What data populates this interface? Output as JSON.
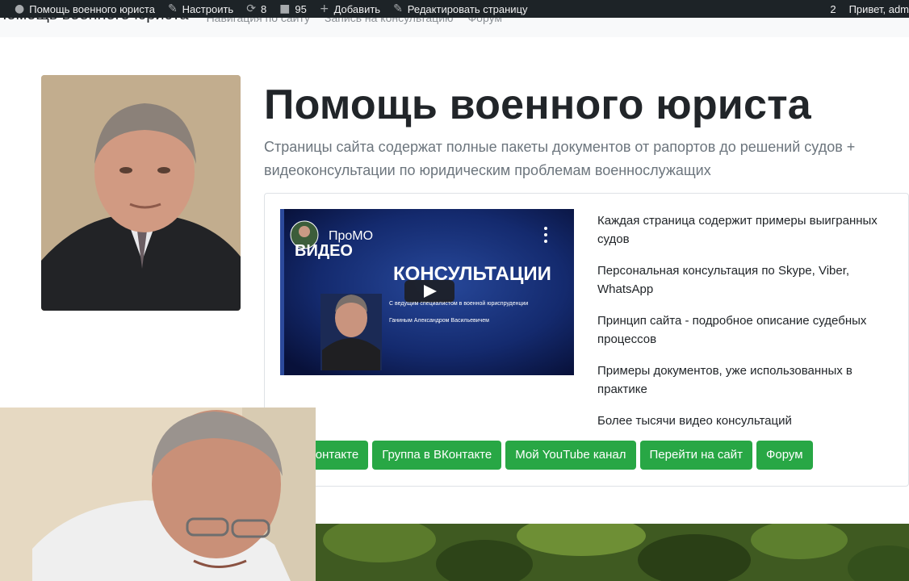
{
  "adminbar": {
    "site_name": "Помощь военного юриста",
    "customize": "Настроить",
    "updates_count": "8",
    "comments_count": "95",
    "add_new": "Добавить",
    "edit_page": "Редактировать страницу",
    "notifications_count": "2",
    "greeting": "Привет, adm"
  },
  "navbar": {
    "brand": "Помощь военного юриста",
    "links": [
      "Навигация по сайту",
      "Запись на консультацию",
      "Форум"
    ]
  },
  "hero": {
    "title": "Помощь военного юриста",
    "lead": "Страницы сайта содержат полные пакеты документов от рапортов до решений судов + видеоконсультации по юридическим проблемам военнослужащих"
  },
  "video": {
    "channel": "ПроМО",
    "title_top": "ВИДЕО",
    "title_main": "КОНСУЛЬТАЦИИ",
    "subtitle": "С ведущим специалистом в военной юриспруденции",
    "presenter": "Ганиным Александром Васильевичем"
  },
  "features": [
    "Каждая страница содержит примеры выигранных судов",
    "Персональная консультация по Skype, Viber, WhatsApp",
    "Принцип сайта - подробное описание судебных процессов",
    "Примеры документов, уже использованных в практике",
    "Более тысячи видео консультаций"
  ],
  "buttons": [
    "ВКонтакте",
    "Группа в ВКонтакте",
    "Мой YouTube канал",
    "Перейти на сайт",
    "Форум"
  ],
  "colors": {
    "adminbar": "#1d2327",
    "button": "#28a745",
    "camo": "#3f5a21"
  }
}
